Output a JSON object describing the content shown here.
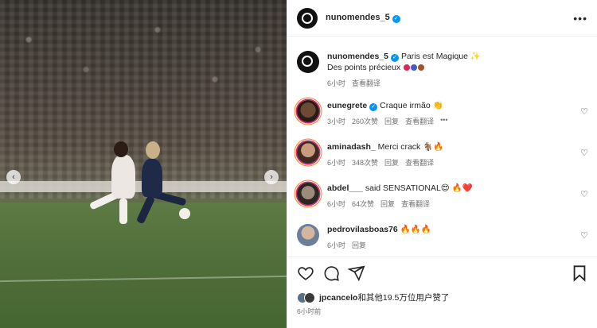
{
  "post": {
    "author": "nunomendes_5",
    "more_label": "•••"
  },
  "caption": {
    "username": "nunomendes_5",
    "text1": "Paris est Magique ✨",
    "text2": "Des points précieux",
    "time": "6小时",
    "translate": "查看翻译"
  },
  "comments": [
    {
      "username": "eunegrete",
      "verified": true,
      "text": "Craque irmão 👏",
      "time": "3小时",
      "likes": "260次赞",
      "reply": "回复",
      "translate": "查看翻译",
      "more": "•••"
    },
    {
      "username": "aminadash_",
      "verified": false,
      "text": "Merci crack 🐐🔥",
      "time": "6小时",
      "likes": "348次赞",
      "reply": "回复",
      "translate": "查看翻译"
    },
    {
      "username": "abdel___",
      "verified": false,
      "text": "said SENSATIONAL😍 🔥❤️",
      "time": "6小时",
      "likes": "64次赞",
      "reply": "回复",
      "translate": "查看翻译"
    },
    {
      "username": "pedrovilasboas76",
      "verified": false,
      "text": "🔥🔥🔥",
      "time": "6小时",
      "reply": "回复"
    }
  ],
  "likes": {
    "liker": "jpcancelo",
    "rest": "和其他19.5万位用户赞了"
  },
  "timestamp": "6小时前",
  "icons": {
    "like": "heart-icon",
    "comment": "comment-icon",
    "share": "share-icon",
    "save": "bookmark-icon"
  },
  "colors": {
    "verified": "#0095f6",
    "text": "#262626",
    "muted": "#737373"
  }
}
